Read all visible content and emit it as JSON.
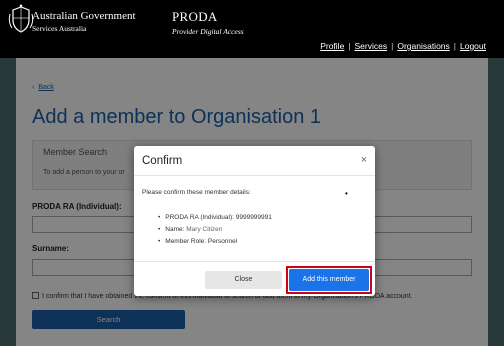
{
  "header": {
    "gov_name": "Australian Government",
    "gov_sub": "Services Australia",
    "app_name": "PRODA",
    "app_sub": "Provider Digital Access",
    "nav": [
      {
        "label": "Profile"
      },
      {
        "label": "Services"
      },
      {
        "label": "Organisations"
      },
      {
        "label": "Logout"
      }
    ]
  },
  "page": {
    "back_label": "Back",
    "title_prefix": "Add a member to ",
    "title_org": "Organisation 1",
    "panel_title": "Member Search",
    "panel_text": "To add a person to your or",
    "label_ra": "PRODA RA (Individual):",
    "label_surname": "Surname:",
    "consent_text": "I confirm that I have obtained the consent of this individual to search or add them to my Organisation's PRODA account.",
    "search_button": "Search"
  },
  "modal": {
    "title": "Confirm",
    "close_icon": "×",
    "confirm_text": "Please confirm these member details:",
    "dot": "•",
    "details": [
      {
        "label": "PRODA RA (Individual):",
        "value": "9999999991"
      },
      {
        "label": "Name:",
        "value": "Mary Citizen"
      },
      {
        "label": "Member Role:",
        "value": "Personnel"
      }
    ],
    "close_button": "Close",
    "add_button": "Add this member"
  }
}
